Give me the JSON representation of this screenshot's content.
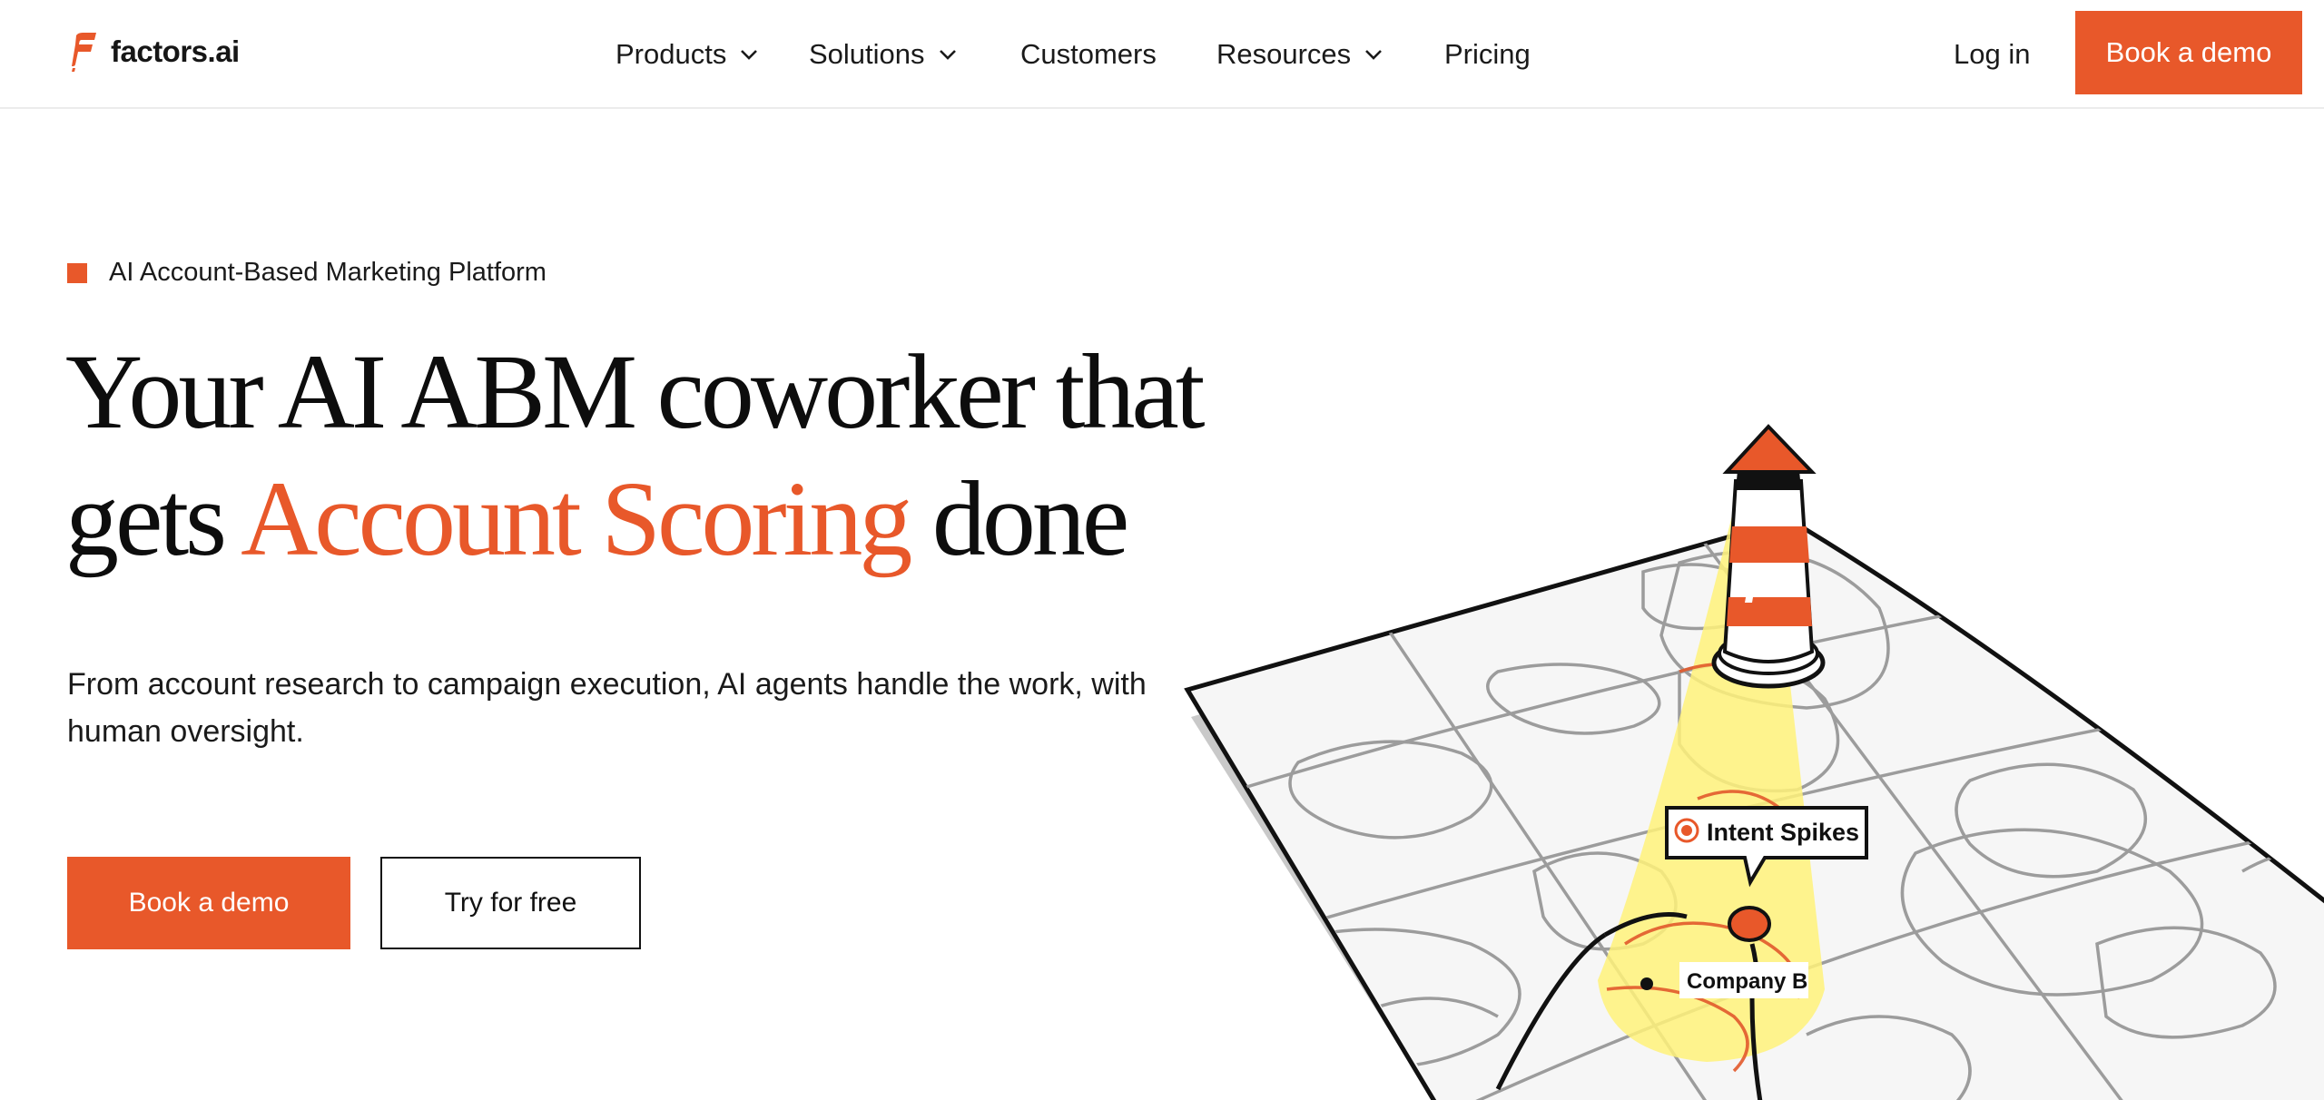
{
  "brand": {
    "name": "factors.ai",
    "accent_color": "#e8582a"
  },
  "nav": {
    "items": [
      {
        "label": "Products",
        "has_dropdown": true
      },
      {
        "label": "Solutions",
        "has_dropdown": true
      },
      {
        "label": "Customers",
        "has_dropdown": false
      },
      {
        "label": "Resources",
        "has_dropdown": true
      },
      {
        "label": "Pricing",
        "has_dropdown": false
      }
    ],
    "login_label": "Log in",
    "cta_label": "Book a demo"
  },
  "hero": {
    "eyebrow": "AI Account-Based Marketing Platform",
    "headline_line1": "Your AI ABM coworker that",
    "headline_prefix": "gets",
    "headline_accent": "Account Scoring",
    "headline_suffix": "done",
    "subtext": "From account research to campaign execution, AI agents handle the work, with human oversight.",
    "primary_cta": "Book a demo",
    "secondary_cta": "Try for free"
  },
  "illustration": {
    "tag_intent": "Intent Spikes",
    "tag_company": "Company B",
    "spotlight_color": "#fff27a"
  }
}
